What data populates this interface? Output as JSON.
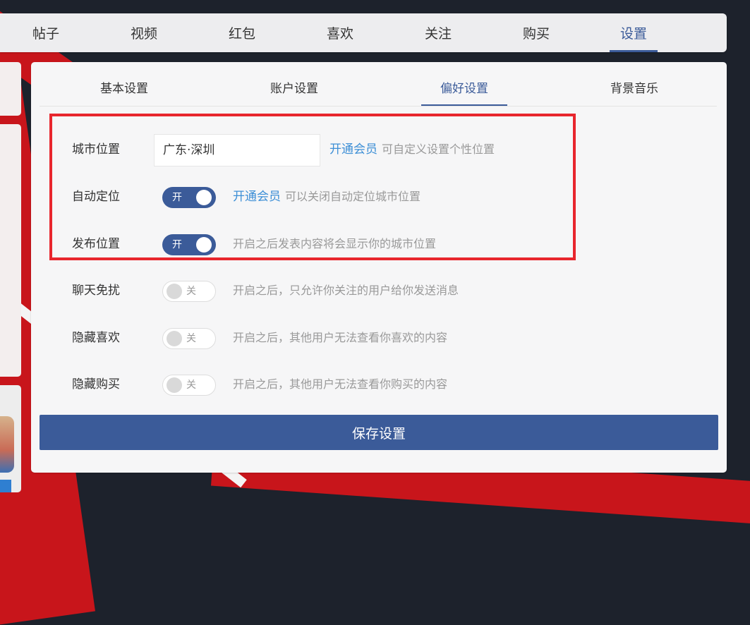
{
  "top_tabs": [
    "帖子",
    "视频",
    "红包",
    "喜欢",
    "关注",
    "购买",
    "设置"
  ],
  "active_top_tab": "设置",
  "sub_tabs": [
    "基本设置",
    "账户设置",
    "偏好设置",
    "背景音乐"
  ],
  "active_sub_tab": "偏好设置",
  "settings": {
    "city": {
      "label": "城市位置",
      "value": "广东·深圳",
      "vip_link": "开通会员",
      "description": "可自定义设置个性位置"
    },
    "auto_locate": {
      "label": "自动定位",
      "state": "开",
      "vip_link": "开通会员",
      "description": "可以关闭自动定位城市位置"
    },
    "publish_location": {
      "label": "发布位置",
      "state": "开",
      "description": "开启之后发表内容将会显示你的城市位置"
    },
    "chat_dnd": {
      "label": "聊天免扰",
      "state": "关",
      "description": "开启之后，只允许你关注的用户给你发送消息"
    },
    "hide_likes": {
      "label": "隐藏喜欢",
      "state": "关",
      "description": "开启之后，其他用户无法查看你喜欢的内容"
    },
    "hide_purchases": {
      "label": "隐藏购买",
      "state": "关",
      "description": "开启之后，其他用户无法查看你购买的内容"
    }
  },
  "save_button": "保存设置",
  "colors": {
    "accent": "#3b5b99",
    "link": "#3d8fd6",
    "highlight": "#e8262d"
  }
}
